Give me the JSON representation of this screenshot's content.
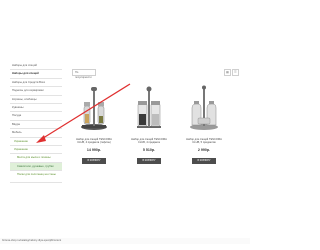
{
  "colors": {
    "accent_green": "#5a8f2a",
    "arrow": "#e03030",
    "button": "#4d4d4d",
    "active_bg": "#dff0d8"
  },
  "sidebar": {
    "items": [
      {
        "label": "Наборы для специй",
        "style": "normal"
      },
      {
        "label": "Наборы для специй",
        "style": "bold"
      },
      {
        "label": "Наборы для Средств Всех",
        "style": "normal"
      },
      {
        "label": "Подносы для сервировки",
        "style": "normal"
      },
      {
        "label": "Корзины, хлебницы",
        "style": "normal"
      },
      {
        "label": "Кувшины",
        "style": "normal"
      },
      {
        "label": "Посуда",
        "style": "normal"
      },
      {
        "label": "Вёдра",
        "style": "normal"
      },
      {
        "label": "Мебель",
        "style": "normal"
      },
      {
        "label": "Украшение",
        "style": "sub"
      },
      {
        "label": "Украшение",
        "style": "sub"
      },
      {
        "label": "Места для мыла и гигиены",
        "style": "sub2"
      },
      {
        "label": "Смесители, душевые, трубки",
        "style": "sub2 active"
      },
      {
        "label": "Полки для полотенец на стены",
        "style": "sub2 tall"
      }
    ]
  },
  "toolbar": {
    "sort_label": "По популярности",
    "grid_icon": "grid-icon",
    "list_icon": "list-icon"
  },
  "products": [
    {
      "title": "Набор для специй TESCOMA CLUB, 4 предмета (тефлон)",
      "price": "14 990р.",
      "button": "В КОРЗИНУ"
    },
    {
      "title": "Набор для специй TESCOMA CLUB, 4 предмета",
      "price": "5 510р.",
      "button": "В КОРЗИНУ"
    },
    {
      "title": "Набор для специй TESCOMA CLUB, 5 предметов",
      "price": "2 990р.",
      "button": "В КОРЗИНУ"
    }
  ],
  "status": {
    "url": "fortuna-shop.ru/catalog/nabory-dlya-specij/#content"
  }
}
